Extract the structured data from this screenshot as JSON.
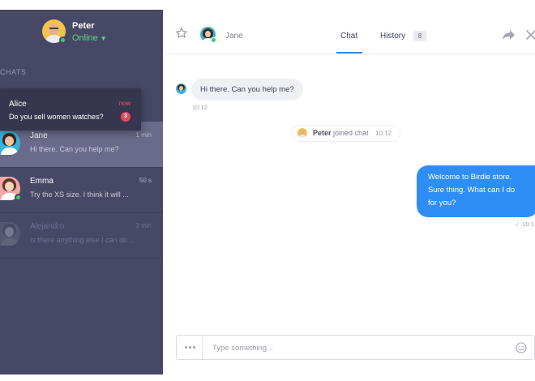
{
  "user": {
    "name": "Peter",
    "status": "Online"
  },
  "sidebar": {
    "section_label": "CHATS",
    "notification": {
      "name": "Alice",
      "preview": "Do you sell women watches?",
      "time": "now",
      "unread": "3"
    },
    "chats": [
      {
        "name": "Jane",
        "preview": "Hi there. Can you help me?",
        "time": "1 min"
      },
      {
        "name": "Emma",
        "preview": "Try the XS size. I think it will ...",
        "time": "50 s"
      },
      {
        "name": "Alejandro",
        "preview": "Is there anything else I can do ...",
        "time": "3 min"
      }
    ]
  },
  "header": {
    "contact_name": "Jane",
    "tabs": {
      "chat": "Chat",
      "history": "History",
      "history_count": "8"
    }
  },
  "messages": {
    "incoming": {
      "text": "Hi there. Can you help me?",
      "time": "10:12"
    },
    "system": {
      "who": "Peter",
      "what": "joined chat",
      "time": "10:12"
    },
    "outgoing": {
      "lines": [
        "Welcome to Birdie store.",
        "Sure thing. What can I do",
        "for you?"
      ],
      "time": "10:1"
    }
  },
  "composer": {
    "placeholder": "Type something..."
  },
  "icons": {
    "star": "star-icon",
    "forward": "forward-icon",
    "close": "close-icon",
    "emoji": "emoji-icon",
    "menu": "more-dots-icon",
    "check": "check-icon"
  },
  "colors": {
    "sidebar": "#474866",
    "active_item": "#6a6b8a",
    "accent_blue": "#2f8ef6",
    "online": "#49c46d",
    "unread": "#e34a5a"
  }
}
